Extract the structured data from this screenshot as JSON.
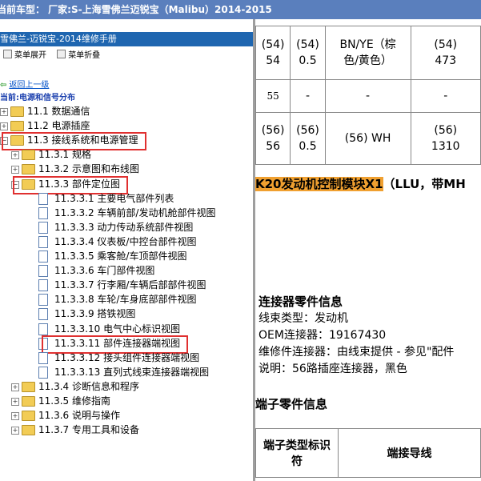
{
  "window": {
    "title": "当前车型：  厂家:S-上海雪佛兰迈锐宝（Malibu）2014-2015"
  },
  "left_panel": {
    "manual_title": "雪佛兰-迈锐宝-2014维修手册",
    "expand_label": "菜单展开",
    "collapse_label": "菜单折叠",
    "back_link": "返回上一级",
    "current_location": "当前:电源和信号分布",
    "tree": [
      {
        "label": "11.1 数据通信",
        "level": 0,
        "type": "folder",
        "toggle": "+"
      },
      {
        "label": "11.2 电源插座",
        "level": 0,
        "type": "folder",
        "toggle": "+"
      },
      {
        "label": "11.3 接线系统和电源管理",
        "level": 0,
        "type": "folder",
        "toggle": "-",
        "highlighted": true
      },
      {
        "label": "11.3.1 规格",
        "level": 1,
        "type": "folder",
        "toggle": "+"
      },
      {
        "label": "11.3.2 示意图和布线图",
        "level": 1,
        "type": "folder",
        "toggle": "+"
      },
      {
        "label": "11.3.3 部件定位图",
        "level": 1,
        "type": "folder",
        "toggle": "-",
        "highlighted": true
      },
      {
        "label": "11.3.3.1 主要电气部件列表",
        "level": 2,
        "type": "doc"
      },
      {
        "label": "11.3.3.2 车辆前部/发动机舱部件视图",
        "level": 2,
        "type": "doc"
      },
      {
        "label": "11.3.3.3 动力传动系统部件视图",
        "level": 2,
        "type": "doc"
      },
      {
        "label": "11.3.3.4 仪表板/中控台部件视图",
        "level": 2,
        "type": "doc"
      },
      {
        "label": "11.3.3.5 乘客舱/车顶部件视图",
        "level": 2,
        "type": "doc"
      },
      {
        "label": "11.3.3.6 车门部件视图",
        "level": 2,
        "type": "doc"
      },
      {
        "label": "11.3.3.7 行李厢/车辆后部部件视图",
        "level": 2,
        "type": "doc"
      },
      {
        "label": "11.3.3.8 车轮/车身底部部件视图",
        "level": 2,
        "type": "doc"
      },
      {
        "label": "11.3.3.9 搭铁视图",
        "level": 2,
        "type": "doc"
      },
      {
        "label": "11.3.3.10 电气中心标识视图",
        "level": 2,
        "type": "doc"
      },
      {
        "label": "11.3.3.11 部件连接器端视图",
        "level": 2,
        "type": "doc",
        "highlighted": true
      },
      {
        "label": "11.3.3.12 接头组件连接器端视图",
        "level": 2,
        "type": "doc"
      },
      {
        "label": "11.3.3.13 直列式线束连接器端视图",
        "level": 2,
        "type": "doc"
      },
      {
        "label": "11.3.4 诊断信息和程序",
        "level": 1,
        "type": "folder",
        "toggle": "+"
      },
      {
        "label": "11.3.5 维修指南",
        "level": 1,
        "type": "folder",
        "toggle": "+"
      },
      {
        "label": "11.3.6 说明与操作",
        "level": 1,
        "type": "folder",
        "toggle": "+"
      },
      {
        "label": "11.3.7 专用工具和设备",
        "level": 1,
        "type": "folder",
        "toggle": "+"
      }
    ]
  },
  "right_panel": {
    "pin_rows": [
      {
        "pin": "(54)\n54",
        "size": "(54)\n0.5",
        "color": "BN/YE（棕\n色/黄色）",
        "circuit": "(54)\n473"
      },
      {
        "pin": "55",
        "size": "-",
        "color": "-",
        "circuit": "-"
      },
      {
        "pin": "(56)\n56",
        "size": "(56)\n0.5",
        "color": "(56) WH",
        "circuit": "(56)\n1310"
      }
    ],
    "component_code": "K20发动机控制模块X1",
    "component_suffix": "（LLU，带MH",
    "connector_heading": "连接器零件信息",
    "connector_lines": [
      "线束类型：发动机",
      "OEM连接器：19167430",
      "维修件连接器：由线束提供 - 参见\"配件",
      "说明：56路插座连接器，黑色"
    ],
    "terminal_heading": "端子零件信息",
    "terminal_table_headers": [
      "端子类型标识\n符",
      "端接导线"
    ]
  }
}
